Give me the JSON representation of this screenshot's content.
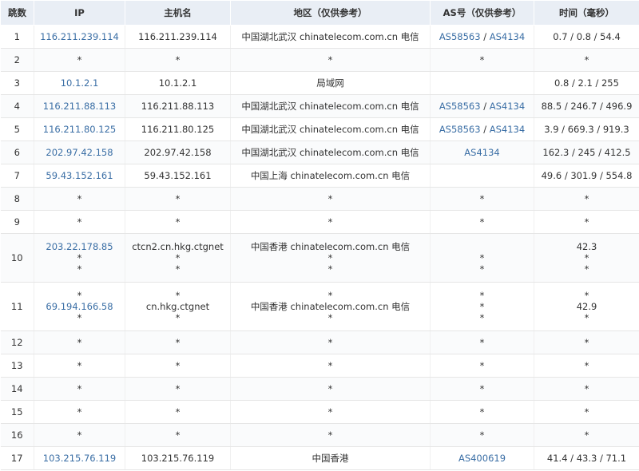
{
  "headers": {
    "hop": "跳数",
    "ip": "IP",
    "host": "主机名",
    "region": "地区（仅供参考）",
    "as": "AS号（仅供参考）",
    "time": "时间（毫秒）"
  },
  "rows": [
    {
      "hop": "1",
      "ip": [
        "116.211.239.114"
      ],
      "host": [
        "116.211.239.114"
      ],
      "region": [
        "中国湖北武汉 chinatelecom.com.cn 电信"
      ],
      "as": [
        [
          "AS58563",
          "AS4134"
        ]
      ],
      "time": [
        "0.7 / 0.8 / 54.4"
      ]
    },
    {
      "hop": "2",
      "ip": [
        "*"
      ],
      "host": [
        "*"
      ],
      "region": [
        "*"
      ],
      "as": [
        [
          "*"
        ]
      ],
      "time": [
        "*"
      ]
    },
    {
      "hop": "3",
      "ip": [
        "10.1.2.1"
      ],
      "host": [
        "10.1.2.1"
      ],
      "region": [
        "局域网"
      ],
      "as": [
        []
      ],
      "time": [
        "0.8 / 2.1 / 255"
      ]
    },
    {
      "hop": "4",
      "ip": [
        "116.211.88.113"
      ],
      "host": [
        "116.211.88.113"
      ],
      "region": [
        "中国湖北武汉 chinatelecom.com.cn 电信"
      ],
      "as": [
        [
          "AS58563",
          "AS4134"
        ]
      ],
      "time": [
        "88.5 / 246.7 / 496.9"
      ]
    },
    {
      "hop": "5",
      "ip": [
        "116.211.80.125"
      ],
      "host": [
        "116.211.80.125"
      ],
      "region": [
        "中国湖北武汉 chinatelecom.com.cn 电信"
      ],
      "as": [
        [
          "AS58563",
          "AS4134"
        ]
      ],
      "time": [
        "3.9 / 669.3 / 919.3"
      ]
    },
    {
      "hop": "6",
      "ip": [
        "202.97.42.158"
      ],
      "host": [
        "202.97.42.158"
      ],
      "region": [
        "中国湖北武汉 chinatelecom.com.cn 电信"
      ],
      "as": [
        [
          "AS4134"
        ]
      ],
      "time": [
        "162.3 / 245 / 412.5"
      ]
    },
    {
      "hop": "7",
      "ip": [
        "59.43.152.161"
      ],
      "host": [
        "59.43.152.161"
      ],
      "region": [
        "中国上海 chinatelecom.com.cn 电信"
      ],
      "as": [
        []
      ],
      "time": [
        "49.6 / 301.9 / 554.8"
      ]
    },
    {
      "hop": "8",
      "ip": [
        "*"
      ],
      "host": [
        "*"
      ],
      "region": [
        "*"
      ],
      "as": [
        [
          "*"
        ]
      ],
      "time": [
        "*"
      ]
    },
    {
      "hop": "9",
      "ip": [
        "*"
      ],
      "host": [
        "*"
      ],
      "region": [
        "*"
      ],
      "as": [
        [
          "*"
        ]
      ],
      "time": [
        "*"
      ]
    },
    {
      "hop": "10",
      "ip": [
        "203.22.178.85",
        "*",
        "*"
      ],
      "host": [
        "ctcn2.cn.hkg.ctgnet",
        "*",
        "*"
      ],
      "region": [
        "中国香港 chinatelecom.com.cn 电信",
        "*",
        "*"
      ],
      "as": [
        [],
        [
          "*"
        ],
        [
          "*"
        ]
      ],
      "time": [
        "42.3",
        "*",
        "*"
      ]
    },
    {
      "hop": "11",
      "ip": [
        "*",
        "69.194.166.58",
        "*"
      ],
      "host": [
        "*",
        "cn.hkg.ctgnet",
        "*"
      ],
      "region": [
        "*",
        "中国香港 chinatelecom.com.cn 电信",
        "*"
      ],
      "as": [
        [
          "*"
        ],
        [
          "*"
        ],
        [
          "*"
        ]
      ],
      "time": [
        "*",
        "42.9",
        "*"
      ]
    },
    {
      "hop": "12",
      "ip": [
        "*"
      ],
      "host": [
        "*"
      ],
      "region": [
        "*"
      ],
      "as": [
        [
          "*"
        ]
      ],
      "time": [
        "*"
      ]
    },
    {
      "hop": "13",
      "ip": [
        "*"
      ],
      "host": [
        "*"
      ],
      "region": [
        "*"
      ],
      "as": [
        [
          "*"
        ]
      ],
      "time": [
        "*"
      ]
    },
    {
      "hop": "14",
      "ip": [
        "*"
      ],
      "host": [
        "*"
      ],
      "region": [
        "*"
      ],
      "as": [
        [
          "*"
        ]
      ],
      "time": [
        "*"
      ]
    },
    {
      "hop": "15",
      "ip": [
        "*"
      ],
      "host": [
        "*"
      ],
      "region": [
        "*"
      ],
      "as": [
        [
          "*"
        ]
      ],
      "time": [
        "*"
      ]
    },
    {
      "hop": "16",
      "ip": [
        "*"
      ],
      "host": [
        "*"
      ],
      "region": [
        "*"
      ],
      "as": [
        [
          "*"
        ]
      ],
      "time": [
        "*"
      ]
    },
    {
      "hop": "17",
      "ip": [
        "103.215.76.119"
      ],
      "host": [
        "103.215.76.119"
      ],
      "region": [
        "中国香港"
      ],
      "as": [
        [
          "AS400619"
        ]
      ],
      "time": [
        "41.4 / 43.3 / 71.1"
      ]
    }
  ],
  "colors": {
    "link": "#3a6ea5",
    "header_bg": "#e9eef5",
    "text": "#333333"
  }
}
